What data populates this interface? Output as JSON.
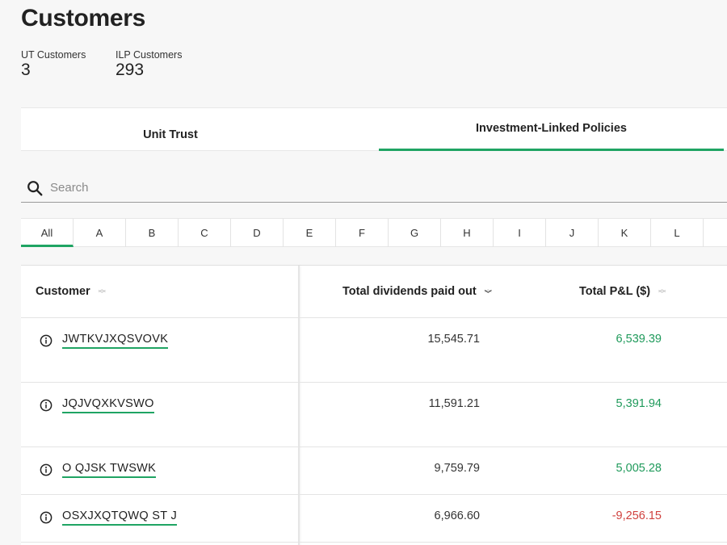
{
  "page": {
    "title": "Customers"
  },
  "stats": {
    "ut": {
      "label": "UT Customers",
      "value": "3"
    },
    "ilp": {
      "label": "ILP Customers",
      "value": "293"
    }
  },
  "tabs": [
    {
      "label": "Unit Trust",
      "active": false
    },
    {
      "label": "Investment-Linked Policies",
      "active": true
    }
  ],
  "search": {
    "placeholder": "Search",
    "value": ""
  },
  "alphabet": [
    "All",
    "A",
    "B",
    "C",
    "D",
    "E",
    "F",
    "G",
    "H",
    "I",
    "J",
    "K",
    "L"
  ],
  "table": {
    "headers": {
      "customer": "Customer",
      "dividends": "Total dividends paid out",
      "pnl": "Total P&L ($)"
    },
    "rows": [
      {
        "customer": "JWTKVJXQSVOVK",
        "dividends": "15,545.71",
        "pnl": "6,539.39",
        "pnl_sign": "positive"
      },
      {
        "customer": "JQJVQXKVSWO",
        "dividends": "11,591.21",
        "pnl": "5,391.94",
        "pnl_sign": "positive"
      },
      {
        "customer": "O QJSK TWSWK",
        "dividends": "9,759.79",
        "pnl": "5,005.28",
        "pnl_sign": "positive"
      },
      {
        "customer": "OSXJXQTQWQ ST J",
        "dividends": "6,966.60",
        "pnl": "-9,256.15",
        "pnl_sign": "negative"
      }
    ]
  },
  "colors": {
    "accent": "#1fa463",
    "positive": "#1f9a5b",
    "negative": "#d0413e"
  }
}
